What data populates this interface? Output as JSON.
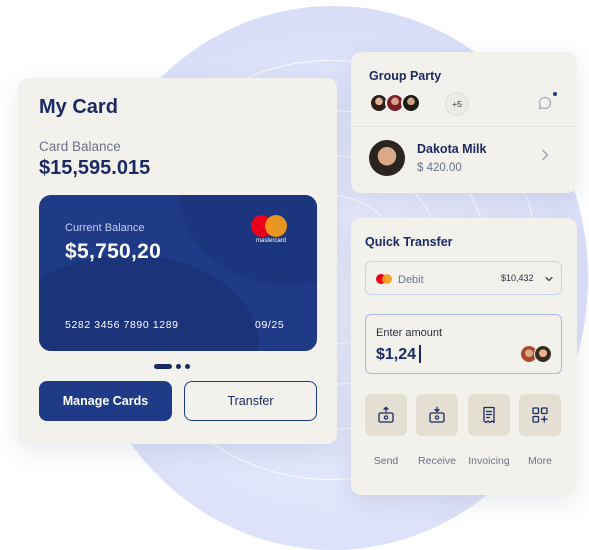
{
  "my_card": {
    "title": "My Card",
    "balance_label": "Card Balance",
    "balance_value": "$15,595.015",
    "card": {
      "current_label": "Current Balance",
      "current_value": "$5,750,20",
      "brand": "mastercard",
      "number": "5282 3456 7890 1289",
      "expiry": "09/25"
    },
    "manage_button": "Manage Cards",
    "transfer_button": "Transfer"
  },
  "group_party": {
    "title": "Group Party",
    "more_count": "+5",
    "contact_name": "Dakota Milk",
    "contact_amount": "$ 420.00"
  },
  "quick_transfer": {
    "title": "Quick Transfer",
    "source_label": "Debit",
    "source_amount": "$10,432",
    "amount_label": "Enter amount",
    "amount_value": "$1,24",
    "actions": [
      {
        "label": "Send",
        "icon": "send-icon"
      },
      {
        "label": "Receive",
        "icon": "receive-icon"
      },
      {
        "label": "Invoicing",
        "icon": "invoice-icon"
      },
      {
        "label": "More",
        "icon": "grid-plus-icon"
      }
    ]
  },
  "colors": {
    "navy": "#1f3a86",
    "panel": "#f3f1ec",
    "action_bg": "#e4dfd2",
    "mastercard_red": "#eb001b",
    "mastercard_orange": "#f79e1b"
  }
}
